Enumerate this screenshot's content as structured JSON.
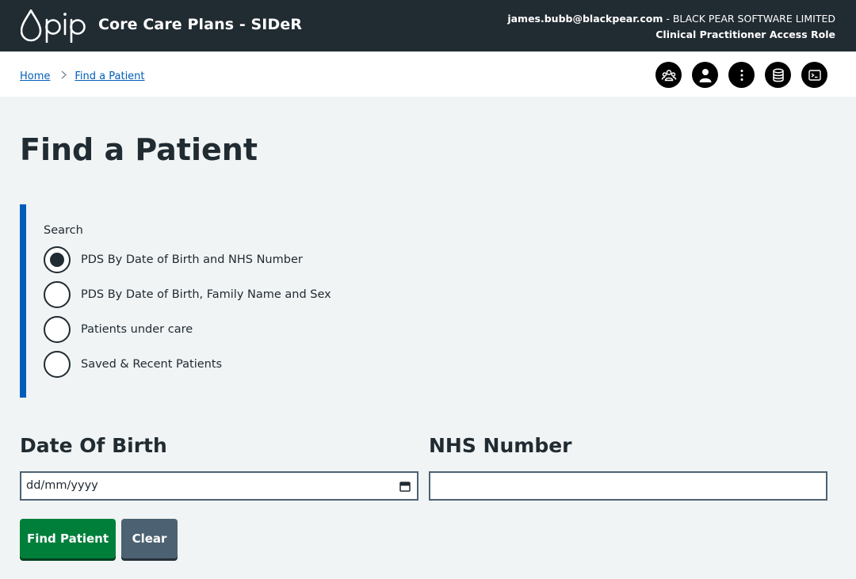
{
  "header": {
    "logo_text": "pip",
    "app_title": "Core Care Plans - SIDeR",
    "user_email": "james.bubb@blackpear.com",
    "user_org": " - BLACK PEAR SOFTWARE LIMITED",
    "role": "Clinical Practitioner Access Role"
  },
  "breadcrumb": {
    "items": [
      {
        "label": "Home"
      },
      {
        "label": "Find a Patient"
      }
    ]
  },
  "toolbar": {
    "icons": [
      "group-icon",
      "user-icon",
      "more-vertical-icon",
      "database-icon",
      "terminal-icon"
    ]
  },
  "page": {
    "title": "Find a Patient"
  },
  "search": {
    "legend": "Search",
    "options": [
      {
        "label": "PDS By Date of Birth and NHS Number",
        "selected": true
      },
      {
        "label": "PDS By Date of Birth, Family Name and Sex",
        "selected": false
      },
      {
        "label": "Patients under care",
        "selected": false
      },
      {
        "label": "Saved & Recent Patients",
        "selected": false
      }
    ]
  },
  "form": {
    "dob_label": "Date Of Birth",
    "dob_placeholder": "dd/mm/yyyy",
    "nhs_label": "NHS Number",
    "nhs_value": ""
  },
  "buttons": {
    "find": "Find Patient",
    "clear": "Clear"
  },
  "colors": {
    "header_bg": "#212b32",
    "accent_blue": "#005eb8",
    "primary_green": "#007f3b",
    "secondary_grey": "#4c6272"
  }
}
